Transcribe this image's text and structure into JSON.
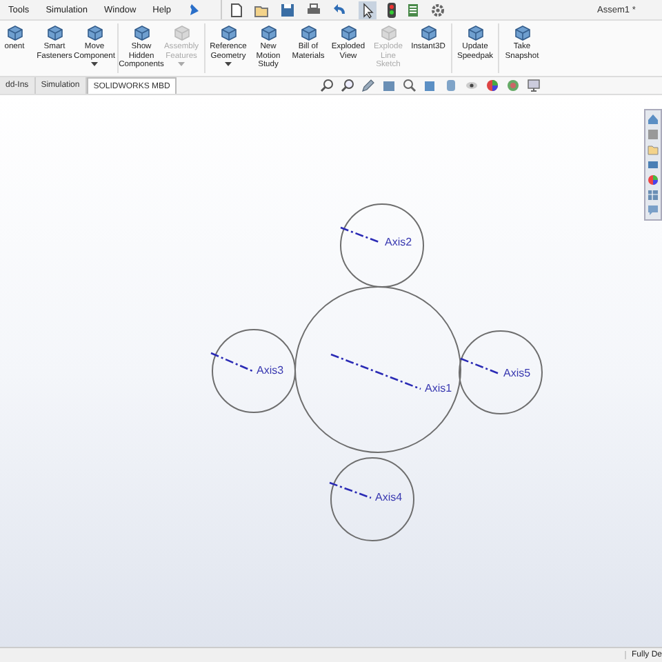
{
  "menu": [
    "Tools",
    "Simulation",
    "Window",
    "Help"
  ],
  "window": {
    "title": "Assem1 *"
  },
  "ribbon": [
    {
      "label": "onent",
      "disabled": false,
      "dropdown": false
    },
    {
      "label": "Smart Fasteners",
      "disabled": false,
      "dropdown": false
    },
    {
      "label": "Move Component",
      "disabled": false,
      "dropdown": true
    },
    {
      "label": "Show Hidden Components",
      "disabled": false,
      "dropdown": false
    },
    {
      "label": "Assembly Features",
      "disabled": true,
      "dropdown": true
    },
    {
      "label": "Reference Geometry",
      "disabled": false,
      "dropdown": true
    },
    {
      "label": "New Motion Study",
      "disabled": false,
      "dropdown": false
    },
    {
      "label": "Bill of Materials",
      "disabled": false,
      "dropdown": false
    },
    {
      "label": "Exploded View",
      "disabled": false,
      "dropdown": false
    },
    {
      "label": "Explode Line Sketch",
      "disabled": true,
      "dropdown": false
    },
    {
      "label": "Instant3D",
      "disabled": false,
      "dropdown": false
    },
    {
      "label": "Update Speedpak",
      "disabled": false,
      "dropdown": false
    },
    {
      "label": "Take Snapshot",
      "disabled": false,
      "dropdown": false
    }
  ],
  "tabs": [
    {
      "label": "dd-Ins",
      "selected": false
    },
    {
      "label": "Simulation",
      "selected": false
    },
    {
      "label": "SOLIDWORKS MBD",
      "selected": true
    }
  ],
  "axes": [
    {
      "label": "Axis2"
    },
    {
      "label": "Axis3"
    },
    {
      "label": "Axis1"
    },
    {
      "label": "Axis5"
    },
    {
      "label": "Axis4"
    }
  ],
  "status_bar": {
    "text": "Fully De"
  }
}
